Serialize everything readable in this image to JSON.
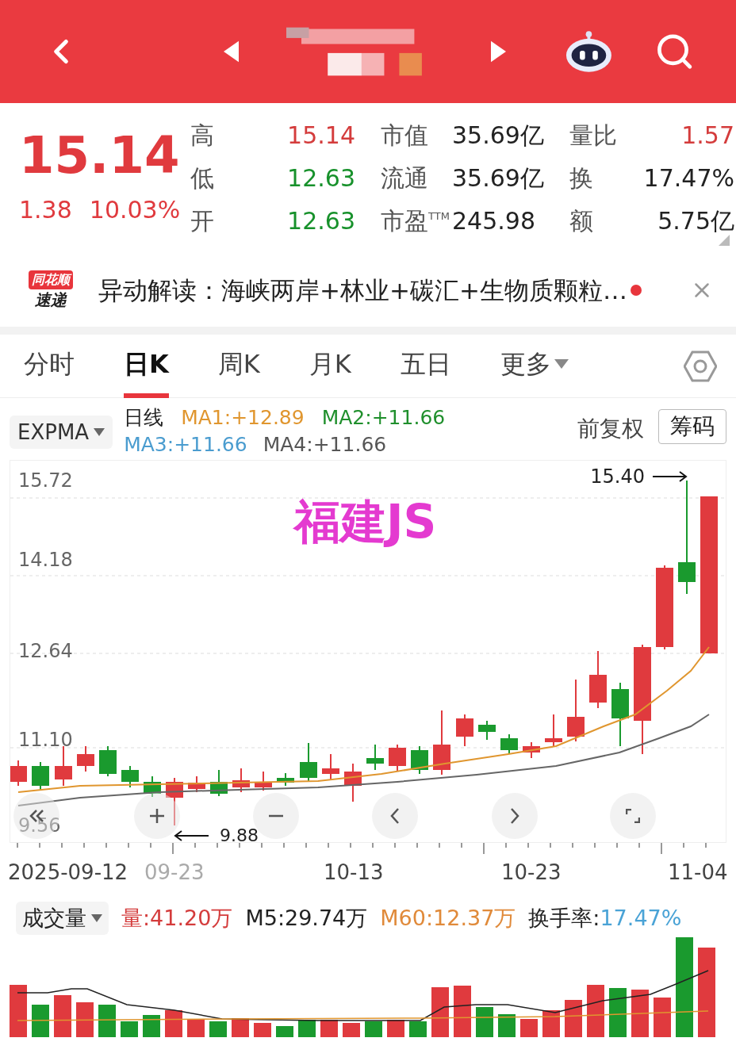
{
  "quote": {
    "price": "15.14",
    "change": "1.38",
    "change_pct": "10.03%",
    "stats": [
      {
        "label": "高",
        "value": "15.14",
        "color": "#d43c3c"
      },
      {
        "label": "市值",
        "value": "35.69亿",
        "color": "#222222"
      },
      {
        "label": "量比",
        "value": "1.57",
        "color": "#d43c3c"
      },
      {
        "label": "低",
        "value": "12.63",
        "color": "#17912b"
      },
      {
        "label": "流通",
        "value": "35.69亿",
        "color": "#222222"
      },
      {
        "label": "换",
        "value": "17.47%",
        "color": "#222222"
      },
      {
        "label": "开",
        "value": "12.63",
        "color": "#17912b"
      },
      {
        "label": "市盈$^{TTM}$",
        "value": "245.98",
        "color": "#222222"
      },
      {
        "label": "额",
        "value": "5.75亿",
        "color": "#222222"
      }
    ]
  },
  "news": {
    "logo_top": "同花顺",
    "logo_bottom": "速递",
    "text": "异动解读：海峡两岸+林业+碳汇+生物质颗粒…",
    "unread": true
  },
  "tabs": [
    {
      "label": "分时",
      "selected": false,
      "kind": "tab"
    },
    {
      "label": "日K",
      "selected": true,
      "kind": "tab"
    },
    {
      "label": "周K",
      "selected": false,
      "kind": "tab"
    },
    {
      "label": "月K",
      "selected": false,
      "kind": "tab"
    },
    {
      "label": "五日",
      "selected": false,
      "kind": "tab"
    },
    {
      "label": "更多",
      "selected": false,
      "kind": "menu"
    }
  ],
  "indicator": {
    "selector": "EXPMA",
    "period": "日线",
    "ma": [
      {
        "label": "MA1:+12.89",
        "color": "#e0962f"
      },
      {
        "label": "MA2:+11.66",
        "color": "#1f8f2c"
      },
      {
        "label": "MA3:+11.66",
        "color": "#4a9ccf"
      },
      {
        "label": "MA4:+11.66",
        "color": "#555555"
      }
    ],
    "adjust": "前复权",
    "chips_button": "筹码"
  },
  "chart": {
    "overlay_label": "福建JS",
    "y_labels": [
      "15.72",
      "14.18",
      "12.64",
      "11.10",
      "9.56"
    ],
    "high_mark": "15.40",
    "low_mark": "9.88",
    "dates": [
      {
        "label": "2025-09-12",
        "dimmed": false
      },
      {
        "label": "09-23",
        "dimmed": true
      },
      {
        "label": "10-13",
        "dimmed": false
      },
      {
        "label": "10-23",
        "dimmed": false
      },
      {
        "label": "11-04",
        "dimmed": false
      }
    ]
  },
  "volume": {
    "selector": "成交量",
    "stats": [
      {
        "text": "量:41.20万",
        "color": "#d43c3c"
      },
      {
        "text": "M5:29.74万",
        "color": "#222222"
      },
      {
        "text": "M60:12.37万",
        "color": "#e08a3a"
      },
      {
        "text": "换手率:",
        "color": "#222222"
      },
      {
        "text": "17.47%",
        "color": "#4aa3d6"
      }
    ]
  }
}
